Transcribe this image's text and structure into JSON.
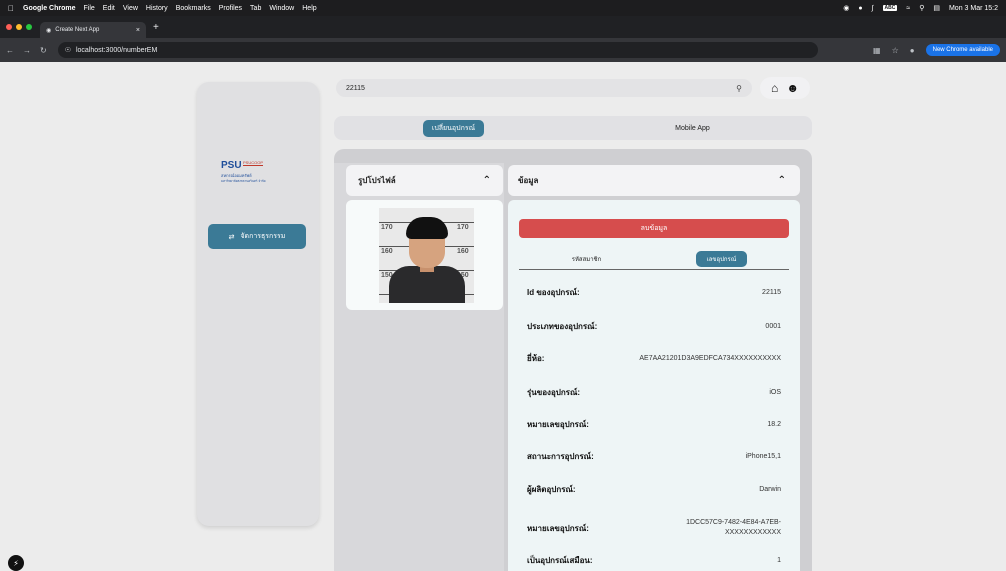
{
  "menubar": {
    "app": "Google Chrome",
    "items": [
      "File",
      "Edit",
      "View",
      "History",
      "Bookmarks",
      "Profiles",
      "Tab",
      "Window",
      "Help"
    ],
    "input_source": "ABC",
    "datetime": "Mon 3 Mar 15:2"
  },
  "browser": {
    "tab_title": "Create Next App",
    "url": "localhost:3000/numberEM",
    "update_label": "New Chrome available"
  },
  "search": {
    "value": "22115"
  },
  "logo": {
    "brand": "PSU",
    "coop": "PSUCOOP",
    "line1": "สหกรณ์ออมทรัพย์",
    "line2": "มหาวิทยาลัยสงขลานครินทร์ จำกัด"
  },
  "sidebar": {
    "manage_label": "จัดการธุรกรรม"
  },
  "tabs": {
    "change_device": "เปลี่ยนอุปกรณ์",
    "mobile_app": "Mobile App"
  },
  "profile": {
    "header": "รูปโปรไฟล์",
    "scale_marks": [
      "170",
      "170",
      "160",
      "160",
      "150",
      "150"
    ]
  },
  "info": {
    "header": "ข้อมูล",
    "delete_label": "ลบข้อมูล",
    "subtab_member": "รหัสสมาชิก",
    "subtab_device": "เลขอุปกรณ์",
    "rows": [
      {
        "label": "Id ของอุปกรณ์:",
        "value": "22115"
      },
      {
        "label": "ประเภทของอุปกรณ์:",
        "value": "0001"
      },
      {
        "label": "ยี่ห้อ:",
        "value": "AE7AA21201D3A9EDFCA734XXXXXXXXXX"
      },
      {
        "label": "รุ่นของอุปกรณ์:",
        "value": "iOS"
      },
      {
        "label": "หมายเลขอุปกรณ์:",
        "value": "18.2"
      },
      {
        "label": "สถานะการอุปกรณ์:",
        "value": "iPhone15,1"
      },
      {
        "label": "ผู้ผลิตอุปกรณ์:",
        "value": "Darwin"
      },
      {
        "label": "หมายเลขอุปกรณ์:",
        "value": "1DCC57C9-7482-4E84-A7EB-XXXXXXXXXXXX"
      },
      {
        "label": "เป็นอุปกรณ์เสมือน:",
        "value": "1"
      }
    ]
  },
  "colors": {
    "accent": "#3b7a96",
    "danger": "#d64d4d",
    "card": "#eef5f6"
  }
}
